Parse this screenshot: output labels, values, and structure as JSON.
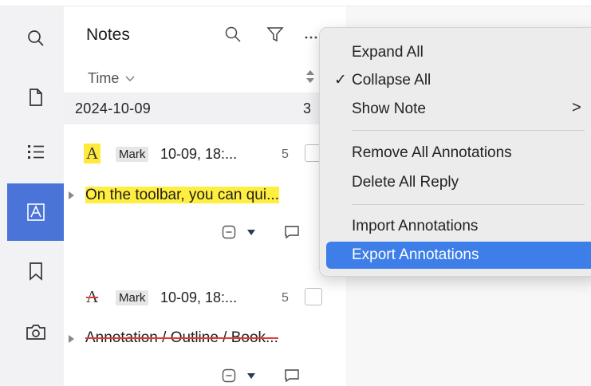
{
  "rail": {
    "items": [
      {
        "name": "search",
        "icon": "search-icon"
      },
      {
        "name": "pages",
        "icon": "page-icon"
      },
      {
        "name": "outline",
        "icon": "list-icon"
      },
      {
        "name": "annotations",
        "icon": "annotation-icon",
        "active": true
      },
      {
        "name": "bookmarks",
        "icon": "bookmark-icon"
      },
      {
        "name": "snapshot",
        "icon": "camera-icon"
      }
    ],
    "active_color": "#4a74d8"
  },
  "panel": {
    "title": "Notes",
    "sort_label": "Time",
    "date_group": {
      "date": "2024-10-09",
      "count": "3"
    }
  },
  "annotations": [
    {
      "type_glyph": "A",
      "style": "highlight",
      "tag": "Mark",
      "meta": "10-09, 18:...",
      "page": "5",
      "text": "On the toolbar, you can qui..."
    },
    {
      "type_glyph": "A",
      "style": "strikethrough",
      "tag": "Mark",
      "meta": "10-09, 18:...",
      "page": "5",
      "text": "Annotation / Outline / Book..."
    }
  ],
  "menu": {
    "items": {
      "expand_all": "Expand All",
      "collapse_all": "Collapse All",
      "collapse_check": "✓",
      "show_note": "Show Note",
      "show_note_arrow": ">",
      "remove_all": "Remove All Annotations",
      "delete_reply": "Delete All Reply",
      "import": "Import Annotations",
      "export": "Export Annotations"
    },
    "highlight_color": "#3d7ee8"
  }
}
